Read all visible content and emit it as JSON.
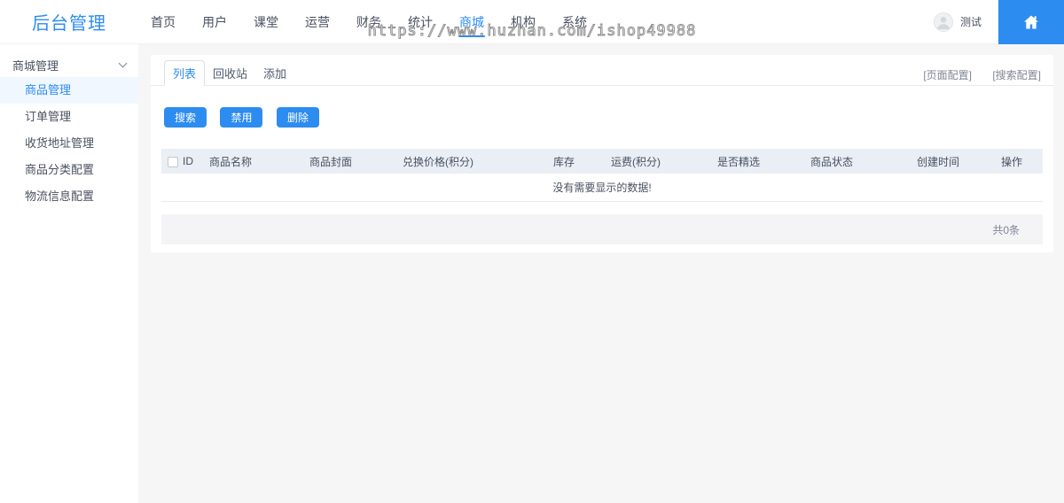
{
  "brand": {
    "title": "后台管理"
  },
  "watermark": "https://www.huzhan.com/ishop49988",
  "topnav": {
    "items": [
      {
        "label": "首页",
        "active": false
      },
      {
        "label": "用户",
        "active": false
      },
      {
        "label": "课堂",
        "active": false
      },
      {
        "label": "运营",
        "active": false
      },
      {
        "label": "财务",
        "active": false
      },
      {
        "label": "统计",
        "active": false
      },
      {
        "label": "商城",
        "active": true
      },
      {
        "label": "机构",
        "active": false
      },
      {
        "label": "系统",
        "active": false
      }
    ],
    "user": {
      "name": "测试"
    },
    "accent_color": "#2d8cf0"
  },
  "sidebar": {
    "group": "商城管理",
    "items": [
      {
        "label": "商品管理",
        "active": true
      },
      {
        "label": "订单管理",
        "active": false
      },
      {
        "label": "收货地址管理",
        "active": false
      },
      {
        "label": "商品分类配置",
        "active": false
      },
      {
        "label": "物流信息配置",
        "active": false
      }
    ]
  },
  "content": {
    "tabs": [
      {
        "label": "列表",
        "active": true
      },
      {
        "label": "回收站",
        "active": false
      },
      {
        "label": "添加",
        "active": false
      }
    ],
    "config_links": [
      "[页面配置]",
      "[搜索配置]"
    ],
    "buttons": [
      "搜索",
      "禁用",
      "删除"
    ],
    "table": {
      "columns": [
        "ID",
        "商品名称",
        "商品封面",
        "兑换价格(积分)",
        "库存",
        "运费(积分)",
        "是否精选",
        "商品状态",
        "创建时间",
        "操作"
      ],
      "empty_text": "没有需要显示的数据!",
      "total_text": "共0条",
      "header_bg": "#eaeef5"
    }
  }
}
